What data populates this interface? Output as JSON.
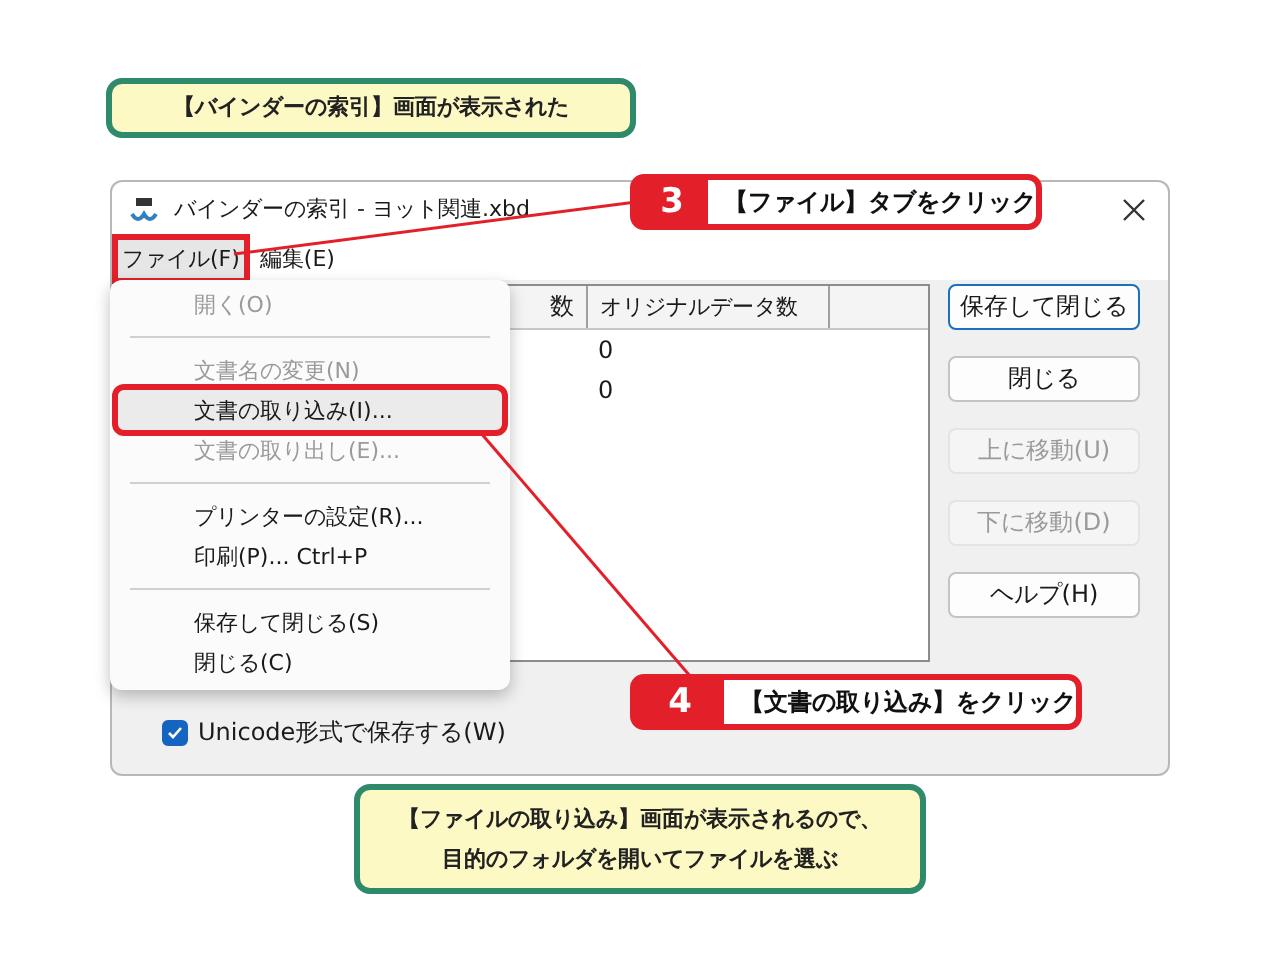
{
  "top_note": {
    "text": "【バインダーの索引】画面が表示された"
  },
  "window": {
    "title": "バインダーの索引 - ヨット関連.xbd",
    "menu": [
      {
        "label": "ファイル(F)",
        "open": true,
        "annotated": true
      },
      {
        "label": "編集(E)",
        "open": false,
        "annotated": false
      }
    ],
    "dropdown": [
      {
        "kind": "item",
        "label": "開く(O)",
        "disabled": true,
        "hovered": false,
        "annotated": false
      },
      {
        "kind": "separator"
      },
      {
        "kind": "item",
        "label": "文書名の変更(N)",
        "disabled": true,
        "hovered": false,
        "annotated": false
      },
      {
        "kind": "item",
        "label": "文書の取り込み(I)...",
        "disabled": false,
        "hovered": true,
        "annotated": true
      },
      {
        "kind": "item",
        "label": "文書の取り出し(E)...",
        "disabled": true,
        "hovered": false,
        "annotated": false
      },
      {
        "kind": "separator"
      },
      {
        "kind": "item",
        "label": "プリンターの設定(R)...",
        "disabled": false,
        "hovered": false,
        "annotated": false
      },
      {
        "kind": "item",
        "label": "印刷(P)... Ctrl+P",
        "disabled": false,
        "hovered": false,
        "annotated": false
      },
      {
        "kind": "separator"
      },
      {
        "kind": "item",
        "label": "保存して閉じる(S)",
        "disabled": false,
        "hovered": false,
        "annotated": false
      },
      {
        "kind": "item",
        "label": "閉じる(C)",
        "disabled": false,
        "hovered": false,
        "annotated": false
      }
    ],
    "table": {
      "columns": [
        "数",
        "オリジナルデータ数"
      ],
      "rows": [
        {
          "original_count": "0"
        },
        {
          "original_count": "0"
        }
      ]
    },
    "buttons": [
      {
        "label": "保存して閉じる",
        "disabled": false,
        "default": true
      },
      {
        "label": "閉じる",
        "disabled": false,
        "default": false
      },
      {
        "label": "上に移動(U)",
        "disabled": true,
        "default": false
      },
      {
        "label": "下に移動(D)",
        "disabled": true,
        "default": false
      },
      {
        "label": "ヘルプ(H)",
        "disabled": false,
        "default": false
      }
    ],
    "checkbox": {
      "label": "Unicode形式で保存する(W)",
      "checked": true
    }
  },
  "callouts": [
    {
      "number": "3",
      "text": "【ファイル】タブをクリック"
    },
    {
      "number": "4",
      "text": "【文書の取り込み】をクリック"
    }
  ],
  "bottom_note": {
    "lines": [
      "【ファイルの取り込み】画面が表示されるので、",
      "目的のフォルダを開いてファイルを選ぶ"
    ]
  }
}
